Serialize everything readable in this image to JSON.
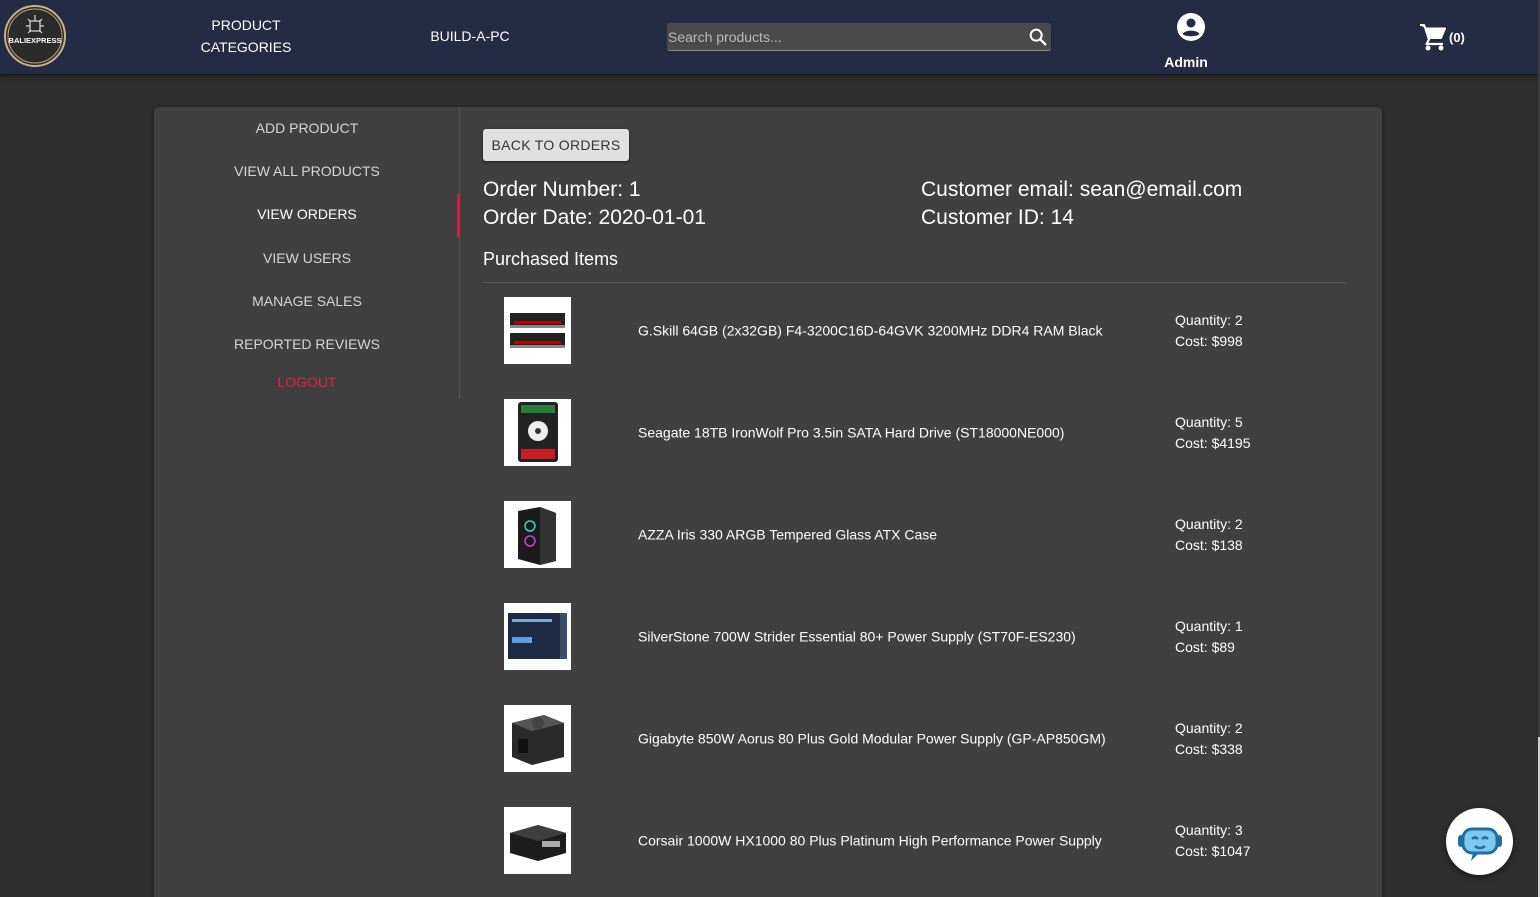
{
  "header": {
    "nav_categories": "PRODUCT CATEGORIES",
    "nav_build": "BUILD-A-PC",
    "search_placeholder": "Search products...",
    "account_label": "Admin",
    "cart_count": "(0)",
    "logo_text": "BALIEXPRESS"
  },
  "sidebar": {
    "items": [
      {
        "label": "ADD PRODUCT"
      },
      {
        "label": "VIEW ALL PRODUCTS"
      },
      {
        "label": "VIEW ORDERS"
      },
      {
        "label": "VIEW USERS"
      },
      {
        "label": "MANAGE SALES"
      },
      {
        "label": "REPORTED REVIEWS"
      }
    ],
    "logout": "LOGOUT"
  },
  "order": {
    "back_label": "BACK TO ORDERS",
    "number": "Order Number: 1",
    "date": "Order Date: 2020-01-01",
    "email": "Customer email: sean@email.com",
    "customer_id": "Customer ID: 14",
    "items_title": "Purchased Items",
    "items": [
      {
        "name": "G.Skill 64GB (2x32GB) F4-3200C16D-64GVK 3200MHz DDR4 RAM Black",
        "quantity": "Quantity: 2",
        "cost": "Cost: $998"
      },
      {
        "name": "Seagate 18TB IronWolf Pro 3.5in SATA Hard Drive (ST18000NE000)",
        "quantity": "Quantity: 5",
        "cost": "Cost: $4195"
      },
      {
        "name": "AZZA Iris 330 ARGB Tempered Glass ATX Case",
        "quantity": "Quantity: 2",
        "cost": "Cost: $138"
      },
      {
        "name": "SilverStone 700W Strider Essential 80+ Power Supply (ST70F-ES230)",
        "quantity": "Quantity: 1",
        "cost": "Cost: $89"
      },
      {
        "name": "Gigabyte 850W Aorus 80 Plus Gold Modular Power Supply (GP-AP850GM)",
        "quantity": "Quantity: 2",
        "cost": "Cost: $338"
      },
      {
        "name": "Corsair 1000W HX1000 80 Plus Platinum High Performance Power Supply",
        "quantity": "Quantity: 3",
        "cost": "Cost: $1047"
      }
    ]
  },
  "colors": {
    "header_bg": "#262b45",
    "logout": "#e5203f",
    "active_indicator": "#d81b43"
  }
}
